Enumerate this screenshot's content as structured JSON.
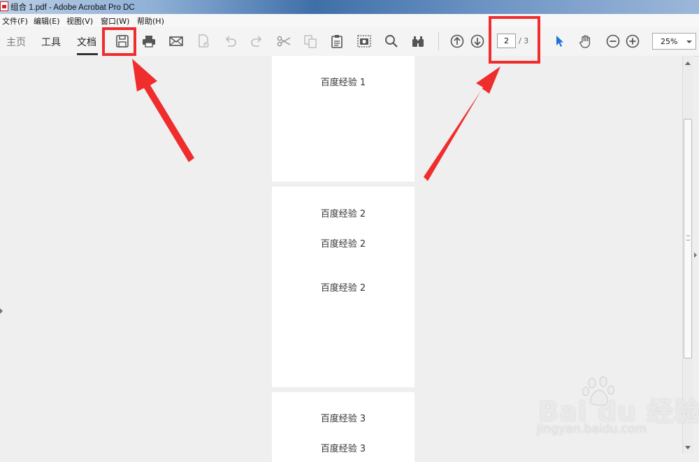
{
  "window": {
    "title": "组合 1.pdf - Adobe Acrobat Pro DC"
  },
  "menu": {
    "items": [
      "文件(F)",
      "编辑(E)",
      "视图(V)",
      "窗口(W)",
      "帮助(H)"
    ]
  },
  "toolbar": {
    "tabs": [
      {
        "label": "主页",
        "active": false
      },
      {
        "label": "工具",
        "active": false
      },
      {
        "label": "文档",
        "active": true
      }
    ],
    "tools": [
      {
        "icon": "save-icon",
        "enabled": true
      },
      {
        "icon": "print-icon",
        "enabled": true
      },
      {
        "icon": "email-icon",
        "enabled": true
      },
      {
        "icon": "secure-document-icon",
        "enabled": false
      },
      {
        "icon": "undo-icon",
        "enabled": false
      },
      {
        "icon": "redo-icon",
        "enabled": false
      },
      {
        "icon": "cut-icon",
        "enabled": false
      },
      {
        "icon": "copy-icon",
        "enabled": false
      },
      {
        "icon": "paste-icon",
        "enabled": true
      },
      {
        "icon": "snapshot-icon",
        "enabled": true
      },
      {
        "icon": "search-icon",
        "enabled": true
      },
      {
        "icon": "binoculars-icon",
        "enabled": true
      },
      {
        "icon": "previous-page-icon",
        "enabled": true
      },
      {
        "icon": "next-page-icon",
        "enabled": true
      },
      {
        "icon": "select-cursor-icon",
        "enabled": true
      },
      {
        "icon": "hand-tool-icon",
        "enabled": true
      },
      {
        "icon": "zoom-out-icon",
        "enabled": true
      },
      {
        "icon": "zoom-in-icon",
        "enabled": true
      }
    ],
    "page_number": "2",
    "page_total": "/ 3",
    "zoom": "25%"
  },
  "document": {
    "pages": [
      {
        "lines": [
          "百度经验 1"
        ]
      },
      {
        "lines": [
          "百度经验 2",
          "百度经验 2",
          "百度经验 2"
        ]
      },
      {
        "lines": [
          "百度经验 3",
          "百度经验 3"
        ]
      }
    ]
  },
  "annotations": {
    "color": "#f02d2d"
  },
  "watermark": {
    "logo": "Bai du 经验",
    "url": "jingyan.baidu.com"
  },
  "colors": {
    "accent_blue": "#1b72d8",
    "highlight_red": "#f02d2d"
  }
}
